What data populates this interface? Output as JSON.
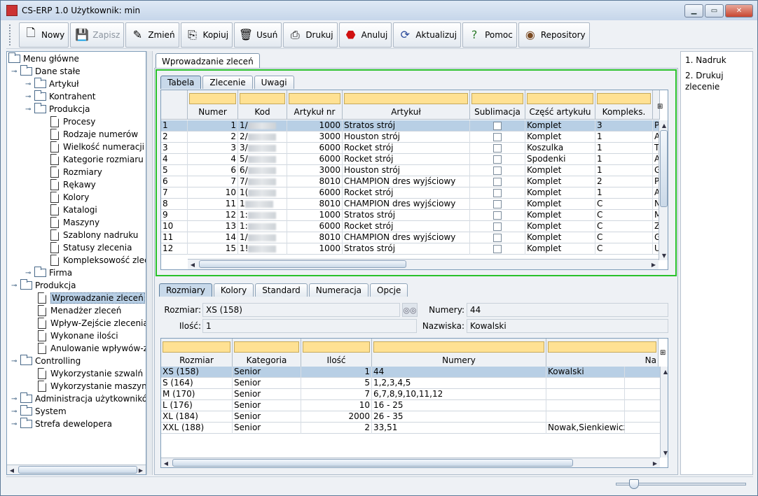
{
  "window": {
    "title": "CS-ERP 1.0  Użytkownik: min"
  },
  "toolbar": [
    {
      "label": "Nowy",
      "icon": "new-document-icon",
      "enabled": true
    },
    {
      "label": "Zapisz",
      "icon": "save-icon",
      "enabled": false
    },
    {
      "label": "Zmień",
      "icon": "edit-pencil-icon",
      "enabled": true
    },
    {
      "label": "Kopiuj",
      "icon": "copy-icon",
      "enabled": true
    },
    {
      "label": "Usuń",
      "icon": "trash-icon",
      "enabled": true
    },
    {
      "label": "Drukuj",
      "icon": "printer-icon",
      "enabled": true
    },
    {
      "label": "Anuluj",
      "icon": "stop-icon",
      "enabled": true
    },
    {
      "label": "Aktualizuj",
      "icon": "refresh-icon",
      "enabled": true
    },
    {
      "label": "Pomoc",
      "icon": "help-icon",
      "enabled": true
    },
    {
      "label": "Repository",
      "icon": "repository-icon",
      "enabled": true
    }
  ],
  "tree": {
    "root": "Menu główne",
    "items": [
      {
        "label": "Dane stałe",
        "type": "folder",
        "level": 1,
        "expanded": true
      },
      {
        "label": "Artykuł",
        "type": "folder",
        "level": 2,
        "expanded": false
      },
      {
        "label": "Kontrahent",
        "type": "folder",
        "level": 2,
        "expanded": false
      },
      {
        "label": "Produkcja",
        "type": "folder",
        "level": 2,
        "expanded": true
      },
      {
        "label": "Procesy",
        "type": "doc",
        "level": 3
      },
      {
        "label": "Rodzaje numerów",
        "type": "doc",
        "level": 3
      },
      {
        "label": "Wielkość numeracji",
        "type": "doc",
        "level": 3
      },
      {
        "label": "Kategorie rozmiaru",
        "type": "doc",
        "level": 3
      },
      {
        "label": "Rozmiary",
        "type": "doc",
        "level": 3
      },
      {
        "label": "Rękawy",
        "type": "doc",
        "level": 3
      },
      {
        "label": "Kolory",
        "type": "doc",
        "level": 3
      },
      {
        "label": "Katalogi",
        "type": "doc",
        "level": 3
      },
      {
        "label": "Maszyny",
        "type": "doc",
        "level": 3
      },
      {
        "label": "Szablony nadruku",
        "type": "doc",
        "level": 3
      },
      {
        "label": "Statusy zlecenia",
        "type": "doc",
        "level": 3
      },
      {
        "label": "Kompleksowość zlecenia",
        "type": "doc",
        "level": 3
      },
      {
        "label": "Firma",
        "type": "folder",
        "level": 2,
        "expanded": false
      },
      {
        "label": "Produkcja",
        "type": "folder",
        "level": 1,
        "expanded": true
      },
      {
        "label": "Wprowadzanie zleceń",
        "type": "doc",
        "level": 2,
        "selected": true
      },
      {
        "label": "Menadżer zleceń",
        "type": "doc",
        "level": 2
      },
      {
        "label": "Wpływ-Zejście zlecenia",
        "type": "doc",
        "level": 2
      },
      {
        "label": "Wykonane ilości",
        "type": "doc",
        "level": 2
      },
      {
        "label": "Anulowanie wpływów-zejść",
        "type": "doc",
        "level": 2
      },
      {
        "label": "Controlling",
        "type": "folder",
        "level": 1,
        "expanded": true
      },
      {
        "label": "Wykorzystanie szwalń",
        "type": "doc",
        "level": 2
      },
      {
        "label": "Wykorzystanie maszyn",
        "type": "doc",
        "level": 2
      },
      {
        "label": "Administracja użytkowników",
        "type": "folder",
        "level": 1,
        "expanded": false
      },
      {
        "label": "System",
        "type": "folder",
        "level": 1,
        "expanded": false
      },
      {
        "label": "Strefa dewelopera",
        "type": "folder",
        "level": 1,
        "expanded": false
      }
    ]
  },
  "main_tab": "Wprowadzanie zleceń",
  "right_panel": [
    "1. Nadruk",
    "2. Drukuj zlecenie"
  ],
  "upper": {
    "tabs": [
      "Tabela",
      "Zlecenie",
      "Uwagi"
    ],
    "active_tab": 0,
    "columns": [
      "",
      "Numer",
      "Kod",
      "Artykuł nr",
      "Artykuł",
      "Sublimacja",
      "Część artykułu",
      "Kompleks.",
      ""
    ],
    "rows": [
      {
        "idx": "1",
        "numer": "1",
        "kod": "1/",
        "art_nr": "1000",
        "artykul": "Stratos strój",
        "subl": false,
        "czesc": "Komplet",
        "kompl": "3",
        "last": "P"
      },
      {
        "idx": "2",
        "numer": "2",
        "kod": "2/",
        "art_nr": "3000",
        "artykul": "Houston strój",
        "subl": false,
        "czesc": "Komplet",
        "kompl": "1",
        "last": "A"
      },
      {
        "idx": "3",
        "numer": "3",
        "kod": "3/",
        "art_nr": "6000",
        "artykul": "Rocket strój",
        "subl": false,
        "czesc": "Koszulka",
        "kompl": "1",
        "last": "T"
      },
      {
        "idx": "4",
        "numer": "4",
        "kod": "5/",
        "art_nr": "6000",
        "artykul": "Rocket strój",
        "subl": false,
        "czesc": "Spodenki",
        "kompl": "1",
        "last": "A"
      },
      {
        "idx": "5",
        "numer": "6",
        "kod": "6/",
        "art_nr": "3000",
        "artykul": "Houston strój",
        "subl": false,
        "czesc": "Komplet",
        "kompl": "1",
        "last": "G"
      },
      {
        "idx": "6",
        "numer": "7",
        "kod": "7/",
        "art_nr": "8010",
        "artykul": "CHAMPION dres wyjściowy",
        "subl": false,
        "czesc": "Komplet",
        "kompl": "2",
        "last": "P"
      },
      {
        "idx": "7",
        "numer": "10",
        "kod": "1(",
        "art_nr": "6000",
        "artykul": "Rocket strój",
        "subl": false,
        "czesc": "Komplet",
        "kompl": "1",
        "last": "A"
      },
      {
        "idx": "8",
        "numer": "11",
        "kod": "1",
        "art_nr": "8010",
        "artykul": "CHAMPION dres wyjściowy",
        "subl": false,
        "czesc": "Komplet",
        "kompl": "C",
        "last": "N"
      },
      {
        "idx": "9",
        "numer": "12",
        "kod": "1:",
        "art_nr": "1000",
        "artykul": "Stratos strój",
        "subl": false,
        "czesc": "Komplet",
        "kompl": "C",
        "last": "M"
      },
      {
        "idx": "10",
        "numer": "13",
        "kod": "1:",
        "art_nr": "6000",
        "artykul": "Rocket strój",
        "subl": false,
        "czesc": "Komplet",
        "kompl": "C",
        "last": "Z"
      },
      {
        "idx": "11",
        "numer": "14",
        "kod": "1/",
        "art_nr": "8010",
        "artykul": "CHAMPION dres wyjściowy",
        "subl": false,
        "czesc": "Komplet",
        "kompl": "C",
        "last": "G"
      },
      {
        "idx": "12",
        "numer": "15",
        "kod": "1!",
        "art_nr": "1000",
        "artykul": "Stratos strój",
        "subl": false,
        "czesc": "Komplet",
        "kompl": "C",
        "last": "U"
      }
    ]
  },
  "lower": {
    "tabs": [
      "Rozmiary",
      "Kolory",
      "Standard",
      "Numeracja",
      "Opcje"
    ],
    "active_tab": 0,
    "form": {
      "rozmiar_label": "Rozmiar:",
      "rozmiar_value": "XS (158)",
      "ilosc_label": "Ilość:",
      "ilosc_value": "1",
      "numery_label": "Numery:",
      "numery_value": "44",
      "nazwiska_label": "Nazwiska:",
      "nazwiska_value": "Kowalski"
    },
    "columns": [
      "Rozmiar",
      "Kategoria",
      "Ilość",
      "Numery",
      "Na"
    ],
    "rows": [
      {
        "rozmiar": "XS (158)",
        "kategoria": "Senior",
        "ilosc": "1",
        "numery": "44",
        "nazwiska": "Kowalski"
      },
      {
        "rozmiar": "S (164)",
        "kategoria": "Senior",
        "ilosc": "5",
        "numery": "1,2,3,4,5",
        "nazwiska": ""
      },
      {
        "rozmiar": "M (170)",
        "kategoria": "Senior",
        "ilosc": "7",
        "numery": "6,7,8,9,10,11,12",
        "nazwiska": ""
      },
      {
        "rozmiar": "L (176)",
        "kategoria": "Senior",
        "ilosc": "10",
        "numery": "16 - 25",
        "nazwiska": ""
      },
      {
        "rozmiar": "XL (184)",
        "kategoria": "Senior",
        "ilosc": "2000",
        "numery": "26 - 35",
        "nazwiska": ""
      },
      {
        "rozmiar": "XXL (188)",
        "kategoria": "Senior",
        "ilosc": "2",
        "numery": "33,51",
        "nazwiska": "Nowak,Sienkiewicz"
      }
    ]
  }
}
